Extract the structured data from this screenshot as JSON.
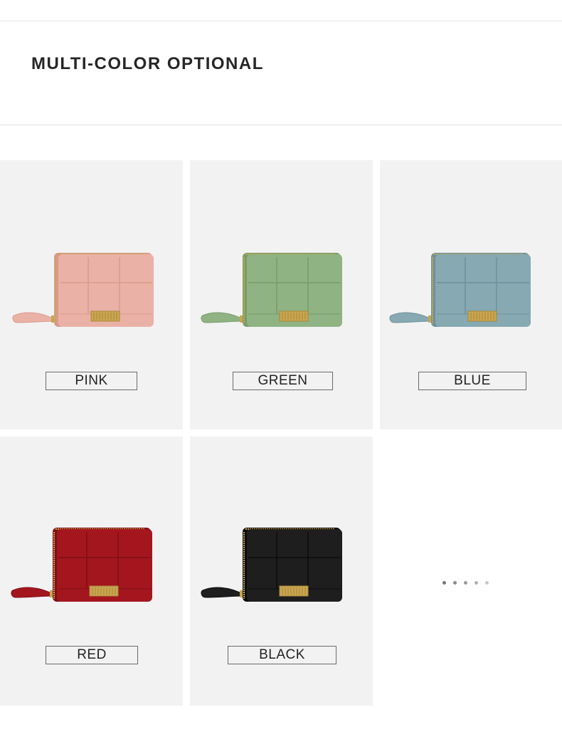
{
  "header": {
    "title": "MULTI-COLOR OPTIONAL"
  },
  "variants": [
    {
      "label": "PINK",
      "color": "#eab2a6",
      "dark": "#d99a8c"
    },
    {
      "label": "GREEN",
      "color": "#8fb382",
      "dark": "#779c6a"
    },
    {
      "label": "BLUE",
      "color": "#86a9b2",
      "dark": "#6d919a"
    },
    {
      "label": "RED",
      "color": "#a4161e",
      "dark": "#7f0f15"
    },
    {
      "label": "BLACK",
      "color": "#1e1e1e",
      "dark": "#0c0c0c"
    }
  ],
  "colors": {
    "card_bg": "#f2f2f2",
    "clasp": "#c9a64f",
    "title": "#262626"
  },
  "pagination": {
    "count": 5,
    "active": 0,
    "dot_colors": [
      "#777777",
      "#8a8a8a",
      "#9a9a9a",
      "#b0b0b0",
      "#c8c8c8"
    ]
  }
}
